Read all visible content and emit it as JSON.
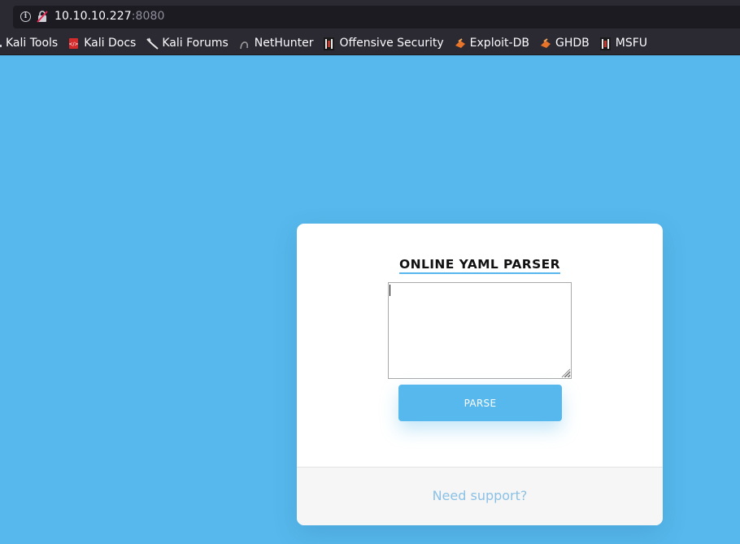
{
  "browser": {
    "url_host": "10.10.10.227",
    "url_port": ":8080",
    "info_icon": "info-icon",
    "security_icon": "insecure-lock-icon",
    "bookmarks": [
      {
        "label": "Kali Tools",
        "icon": "kali-tools-icon"
      },
      {
        "label": "Kali Docs",
        "icon": "kali-docs-icon"
      },
      {
        "label": "Kali Forums",
        "icon": "kali-forums-icon"
      },
      {
        "label": "NetHunter",
        "icon": "nethunter-icon"
      },
      {
        "label": "Offensive Security",
        "icon": "offensive-security-icon"
      },
      {
        "label": "Exploit-DB",
        "icon": "exploit-db-icon"
      },
      {
        "label": "GHDB",
        "icon": "ghdb-icon"
      },
      {
        "label": "MSFU",
        "icon": "msfu-icon"
      }
    ]
  },
  "page": {
    "background_color": "#56b8ec",
    "title": "ONLINE YAML PARSER",
    "input_value": "",
    "parse_label": "PARSE",
    "support_label": "Need support?",
    "accent_color": "#56b8ec",
    "link_color": "#8cc1e5"
  }
}
